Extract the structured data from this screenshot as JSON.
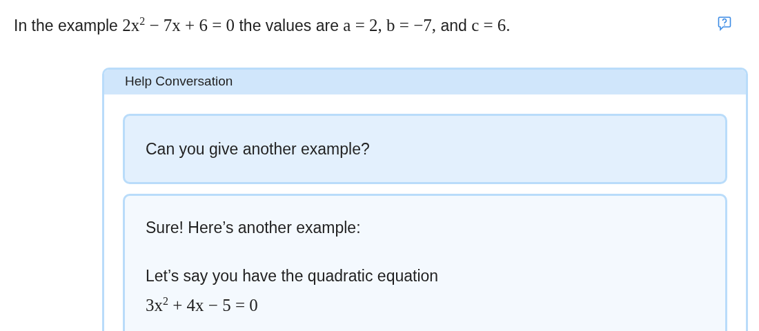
{
  "intro": [
    {
      "kind": "text",
      "text": "In the example "
    },
    {
      "kind": "math",
      "text": "2x$^{2}$ − 7x + 6 = 0"
    },
    {
      "kind": "text",
      "text": " the values are "
    },
    {
      "kind": "math",
      "text": "a = 2, b = −7,"
    },
    {
      "kind": "text",
      "text": " and "
    },
    {
      "kind": "math",
      "text": "c = 6."
    }
  ],
  "panel": {
    "title": "Help Conversation",
    "messages": [
      {
        "kind": "question",
        "paragraphs": [
          [
            {
              "kind": "text",
              "text": "Can you give another example?"
            }
          ]
        ]
      },
      {
        "kind": "answer",
        "paragraphs": [
          [
            {
              "kind": "text",
              "text": "Sure! Here’s another example:"
            }
          ],
          [
            {
              "kind": "text",
              "text": "Let’s say you have the quadratic equation"
            }
          ],
          [
            {
              "kind": "math",
              "text": "3x$^{2}$ + 4x − 5 = 0"
            }
          ]
        ]
      }
    ]
  }
}
